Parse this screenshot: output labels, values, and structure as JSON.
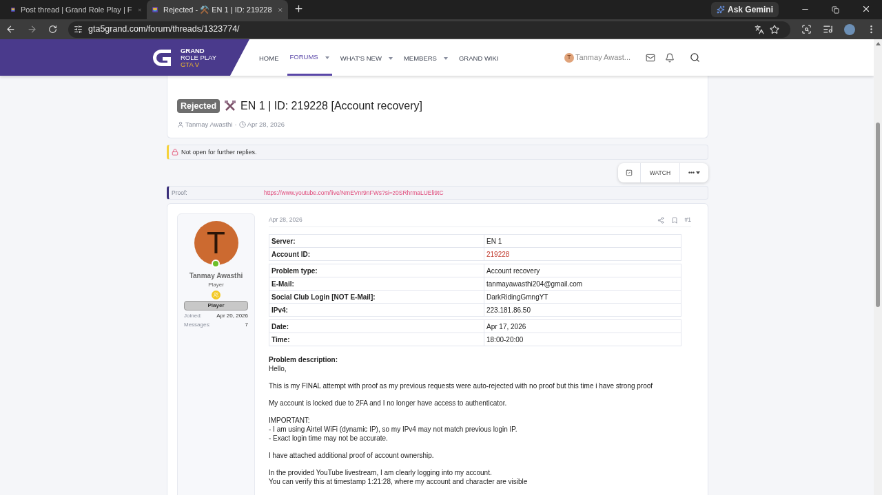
{
  "browser": {
    "tabs": [
      {
        "title": "Post thread | Grand Role Play | F",
        "selected": false
      },
      {
        "title": "Rejected - ⚒️ EN 1 | ID: 219228",
        "selected": true
      }
    ],
    "gemini": "Ask Gemini",
    "url": "gta5grand.com/forum/threads/1323774/"
  },
  "header": {
    "logo": {
      "line1": "GRAND",
      "line2": "ROLE PLAY",
      "line3": "GTA V"
    },
    "nav": [
      {
        "label": "HOME",
        "selected": false,
        "dropdown": false
      },
      {
        "label": "FORUMS",
        "selected": true,
        "dropdown": true
      },
      {
        "label": "WHAT'S NEW",
        "selected": false,
        "dropdown": true
      },
      {
        "label": "MEMBERS",
        "selected": false,
        "dropdown": true
      },
      {
        "label": "GRAND WIKI",
        "selected": false,
        "dropdown": false
      }
    ],
    "user": {
      "initial": "T",
      "name": "Tanmay Awast..."
    }
  },
  "thread": {
    "prefix": "Rejected",
    "title": "EN 1 | ID: 219228 [Account recovery]",
    "author": "Tanmay Awasthi",
    "separator": "·",
    "date": "Apr 28, 2026"
  },
  "notice": "Not open for further replies.",
  "actions": {
    "watch": "WATCH",
    "more": "•••"
  },
  "field": {
    "label": "Proof:",
    "value": "https://www.youtube.com/live/NmEVnr9nFWs?si=z0SRhrmaLUEli9tC"
  },
  "post": {
    "user": {
      "initial": "T",
      "name": "Tanmay Awasthi",
      "title": "Player",
      "banner": "Player",
      "online": true,
      "stats": [
        {
          "label": "Joined:",
          "value": "Apr 20, 2026"
        },
        {
          "label": "Messages:",
          "value": "7"
        }
      ]
    },
    "date": "Apr 28, 2026",
    "number": "#1",
    "table": {
      "groups": [
        [
          {
            "label": "Server:",
            "value": "EN 1",
            "highlight": false
          },
          {
            "label": "Account ID:",
            "value": "219228",
            "highlight": true
          }
        ],
        [
          {
            "label": "Problem type:",
            "value": "Account recovery",
            "highlight": false
          },
          {
            "label": "E-Mail:",
            "value": "tanmayawasthi204@gmail.com",
            "highlight": false
          },
          {
            "label": "Social Club Login [NOT E-Mail]:",
            "value": "DarkRidingGmngYT",
            "highlight": false
          },
          {
            "label": "IPv4:",
            "value": "223.181.86.50",
            "highlight": false
          }
        ],
        [
          {
            "label": "Date:",
            "value": "Apr 17, 2026",
            "highlight": false
          },
          {
            "label": "Time:",
            "value": "18:00-20:00",
            "highlight": false
          }
        ]
      ]
    },
    "description_label": "Problem description:",
    "paragraphs": [
      [
        "Hello,"
      ],
      [
        "This is my FINAL attempt with proof as my previous requests were auto-rejected with no proof but this time i have strong proof"
      ],
      [
        "My account is locked due to 2FA and I no longer have access to authenticator."
      ],
      [
        "IMPORTANT:",
        "- I am using Airtel WiFi (dynamic IP), so my IPv4 may not match previous login IP.",
        "- Exact login time may not be accurate."
      ],
      [
        "I have attached additional proof of account ownership."
      ],
      [
        "In the provided YouTube livestream, I am clearly logging into my account.",
        "You can verify this at timestamp 1:21:28, where my account and character are visible"
      ]
    ]
  }
}
